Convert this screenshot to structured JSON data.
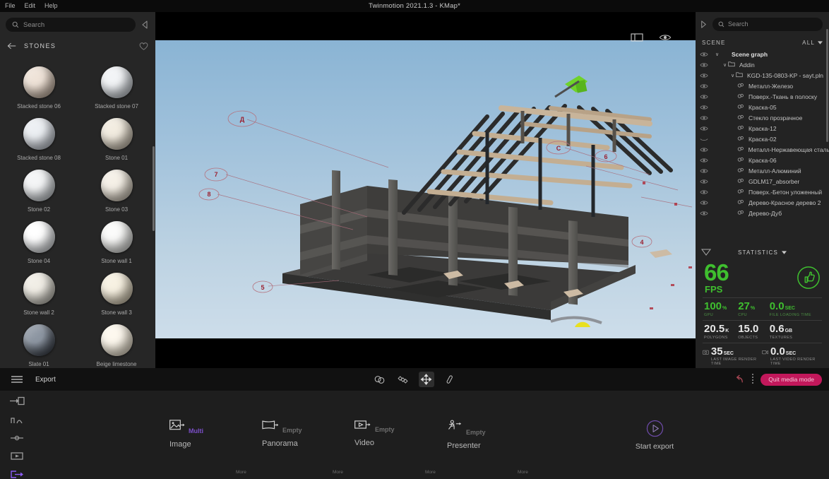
{
  "window": {
    "title": "Twinmotion 2021.1.3 - KMap*",
    "menu": [
      "File",
      "Edit",
      "Help"
    ]
  },
  "library": {
    "search_placeholder": "Search",
    "collapse_icon": "chevron-left-icon",
    "back_icon": "arrow-left-icon",
    "category_title": "STONES",
    "favorite_icon": "heart-icon",
    "materials": [
      {
        "label": "Stacked stone 06",
        "color1": "#efe3d8",
        "color2": "#b9a593"
      },
      {
        "label": "Stacked stone 07",
        "color1": "#f2f4f6",
        "color2": "#b8bfc6"
      },
      {
        "label": "Stacked stone 08",
        "color1": "#eceff3",
        "color2": "#b6bcc6"
      },
      {
        "label": "Stone 01",
        "color1": "#f2ece0",
        "color2": "#bdb2a0"
      },
      {
        "label": "Stone 02",
        "color1": "#f4f5f6",
        "color2": "#b9bfc4"
      },
      {
        "label": "Stone 03",
        "color1": "#f5f0e7",
        "color2": "#c3b9a8"
      },
      {
        "label": "Stone 04",
        "color1": "#ffffff",
        "color2": "#c9cdd1"
      },
      {
        "label": "Stone wall 1",
        "color1": "#fbfbfa",
        "color2": "#cfd0cc"
      },
      {
        "label": "Stone wall 2",
        "color1": "#f1eee6",
        "color2": "#b4b2a8"
      },
      {
        "label": "Stone wall 3",
        "color1": "#f7f1e2",
        "color2": "#c5b99f"
      },
      {
        "label": "Slate 01",
        "color1": "#8e97a3",
        "color2": "#2a2f38"
      },
      {
        "label": "Beige limestone",
        "color1": "#fdf8ee",
        "color2": "#ddd2bc"
      }
    ]
  },
  "viewport": {
    "toolbar_icons": [
      "panel-toggle-icon",
      "eye-icon"
    ]
  },
  "right_panel": {
    "expand_icon": "chevron-right-icon",
    "search_placeholder": "Search",
    "scene_label": "SCENE",
    "filter_label": "ALL",
    "filter_icon": "chevron-down-icon",
    "tree": [
      {
        "label": "Scene graph",
        "depth": 0,
        "type": "root",
        "expanded": true,
        "visible": true,
        "bold": true
      },
      {
        "label": "Addin",
        "depth": 1,
        "type": "folder",
        "expanded": true,
        "visible": true
      },
      {
        "label": "KGD-135-0803-KP - sayt.pln",
        "depth": 2,
        "type": "folder",
        "expanded": true,
        "visible": true
      },
      {
        "label": "Металл-Железо",
        "depth": 3,
        "type": "material",
        "visible": true
      },
      {
        "label": "Поверх.-Ткань в полоску",
        "depth": 3,
        "type": "material",
        "visible": true
      },
      {
        "label": "Краска-05",
        "depth": 3,
        "type": "material",
        "visible": true
      },
      {
        "label": "Стекло прозрачное",
        "depth": 3,
        "type": "material",
        "visible": true
      },
      {
        "label": "Краска-12",
        "depth": 3,
        "type": "material",
        "visible": true
      },
      {
        "label": "Краска-02",
        "depth": 3,
        "type": "material",
        "visible": false
      },
      {
        "label": "Металл-Нержавеющая сталь",
        "depth": 3,
        "type": "material",
        "visible": true
      },
      {
        "label": "Краска-06",
        "depth": 3,
        "type": "material",
        "visible": true
      },
      {
        "label": "Металл-Алюминий",
        "depth": 3,
        "type": "material",
        "visible": true
      },
      {
        "label": "GDLM17_absorber",
        "depth": 3,
        "type": "material",
        "visible": true
      },
      {
        "label": "Поверх.-Бетон уложенный",
        "depth": 3,
        "type": "material",
        "visible": true
      },
      {
        "label": "Дерево-Красное дерево 2",
        "depth": 3,
        "type": "material",
        "visible": true
      },
      {
        "label": "Дерево-Дуб",
        "depth": 3,
        "type": "material",
        "visible": true
      }
    ],
    "statistics": {
      "title": "STATISTICS",
      "collapse_icon": "triangle-down-icon",
      "dropdown_icon": "chevron-down-icon",
      "fps_value": "66",
      "fps_label": "FPS",
      "status_icon": "thumbs-up-icon",
      "accent_green": "#3fbf2f",
      "row1": [
        {
          "value": "100",
          "unit": "%",
          "label": "GPU"
        },
        {
          "value": "27",
          "unit": "%",
          "label": "CPU"
        },
        {
          "value": "0.0",
          "unit": "SEC",
          "label": "FILE LOADING TIME"
        }
      ],
      "row2": [
        {
          "value": "20.5",
          "unit": "K",
          "label": "POLYGONS"
        },
        {
          "value": "15.0",
          "unit": "",
          "label": "OBJECTS"
        },
        {
          "value": "0.6",
          "unit": "GB",
          "label": "TEXTURES"
        }
      ],
      "row3": [
        {
          "icon": "camera-icon",
          "value": "35",
          "unit": "SEC",
          "label": "LAST IMAGE RENDER TIME"
        },
        {
          "icon": "video-icon",
          "value": "0.0",
          "unit": "SEC",
          "label": "LAST VIDEO RENDER TIME"
        }
      ]
    }
  },
  "bottom_toolbar": {
    "menu_icon": "hamburger-icon",
    "mode_label": "Export",
    "tools": [
      "select-icon",
      "material-picker-icon",
      "move-icon",
      "eyedropper-icon"
    ],
    "undo_icon": "undo-icon",
    "quit_label": "Quit media mode",
    "quit_color": "#c2185b"
  },
  "media_panel": {
    "rail_icons": [
      "import-icon",
      "measure-icon",
      "timeline-icon",
      "media-icon",
      "export-icon"
    ],
    "rail_selected_color": "#7b4fc9",
    "items": [
      {
        "name": "Image",
        "tag": "Multi",
        "tag_type": "multi",
        "icon": "image-icon",
        "more": "More"
      },
      {
        "name": "Panorama",
        "tag": "Empty",
        "tag_type": "empty",
        "icon": "panorama-icon",
        "more": "More"
      },
      {
        "name": "Video",
        "tag": "Empty",
        "tag_type": "empty",
        "icon": "video-icon",
        "more": "More"
      },
      {
        "name": "Presenter",
        "tag": "Empty",
        "tag_type": "empty",
        "icon": "presenter-icon",
        "more": "More"
      }
    ],
    "start_export": {
      "label": "Start export",
      "icon": "play-circle-icon"
    }
  }
}
